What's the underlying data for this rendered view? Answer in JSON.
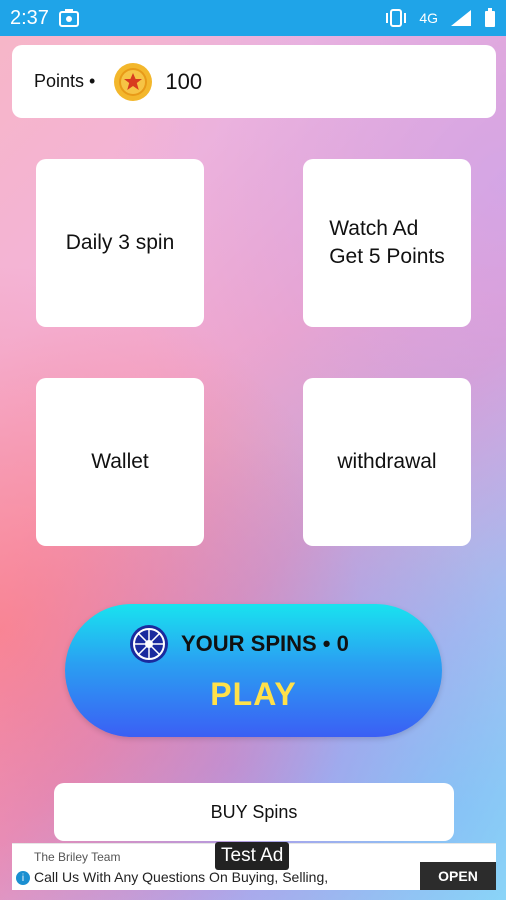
{
  "status_bar": {
    "time": "2:37",
    "network": "4G"
  },
  "points_card": {
    "label": "Points •",
    "value": "100"
  },
  "tiles": [
    {
      "label": "Daily 3 spin"
    },
    {
      "label": "Watch Ad\nGet 5 Points"
    },
    {
      "label": "Wallet"
    },
    {
      "label": "withdrawal"
    }
  ],
  "play_button": {
    "spins_text": "YOUR SPINS • 0",
    "label": "PLAY"
  },
  "buy_button": {
    "label": "BUY Spins"
  },
  "ad": {
    "label": "Test Ad",
    "advertiser": "The Briley Team",
    "text": "Call Us With Any Questions On Buying, Selling,",
    "cta": "OPEN"
  },
  "colors": {
    "status_bar": "#1fa4e8",
    "play_top": "#19e3ef",
    "play_bottom": "#3b5ff4",
    "play_text": "#ffe14a"
  },
  "icons": {
    "status_left": [
      "photo-icon"
    ],
    "status_right": [
      "vibrate-icon",
      "signal-icon",
      "battery-icon"
    ],
    "coin": "coin-icon",
    "spin_wheel": "spin-wheel-icon"
  }
}
